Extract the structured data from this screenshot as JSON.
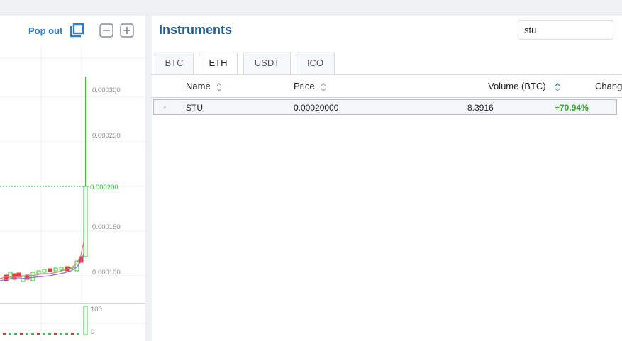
{
  "chart_panel": {
    "popout_label": "Pop out",
    "price_ticks": [
      "0.000300",
      "0.000250",
      "0.000200",
      "0.000150",
      "0.000100"
    ],
    "volume_ticks": [
      "100",
      "0"
    ],
    "current_price": 0.0002,
    "colors": {
      "up": "#33cc33",
      "down": "#e03c3c",
      "current": "#2db82d",
      "ma_fast": "#e07f7f",
      "ma_slow": "#8d6fd8"
    }
  },
  "instruments": {
    "title": "Instruments",
    "search_value": "stu",
    "tabs": [
      {
        "label": "BTC",
        "active": false
      },
      {
        "label": "ETH",
        "active": true
      },
      {
        "label": "USDT",
        "active": false
      },
      {
        "label": "ICO",
        "active": false
      }
    ],
    "columns": {
      "name": "Name",
      "price": "Price",
      "volume": "Volume (BTC)",
      "change": "Chang"
    },
    "rows": [
      {
        "name": "STU",
        "price": "0.00020000",
        "volume": "8.3916",
        "change": "+70.94%"
      }
    ],
    "colors": {
      "accent": "#1f5f8b",
      "positive": "#31a82f",
      "link": "#2a7fd0"
    }
  }
}
